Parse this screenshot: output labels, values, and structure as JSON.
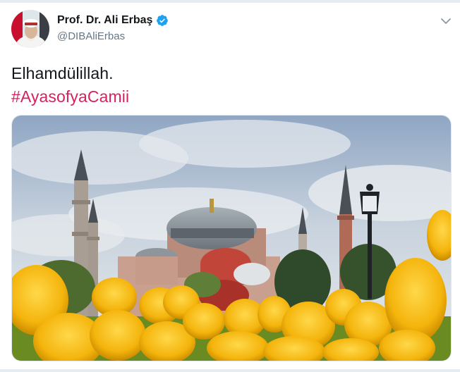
{
  "author": {
    "display_name": "Prof. Dr. Ali Erbaş",
    "handle": "@DIBAliErbas",
    "verified": true
  },
  "tweet": {
    "line1": "Elhamdülillah.",
    "hashtag": "#AyasofyaCamii"
  },
  "icons": {
    "verified": "verified-badge-icon",
    "menu": "chevron-down-icon"
  },
  "colors": {
    "hashtag": "#d5225f",
    "verified": "#1da1f2",
    "secondary_text": "#657786"
  },
  "media": {
    "subject": "Hagia Sophia mosque with yellow tulips"
  }
}
